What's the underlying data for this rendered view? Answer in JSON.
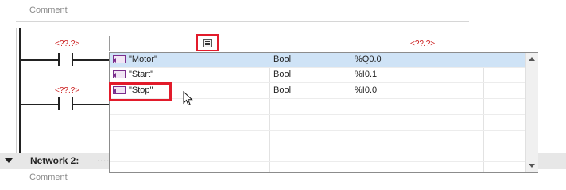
{
  "network1": {
    "comment": "Comment"
  },
  "network2": {
    "title": "Network 2:",
    "dots": "........",
    "comment": "Comment"
  },
  "ladder": {
    "contact1_address": "<??.?>",
    "contact2_address": "<??.?>",
    "coil_address": "<??.?>"
  },
  "operand_input": {
    "value": ""
  },
  "list_button": {
    "icon": "list-icon"
  },
  "tag_list": {
    "rows": [
      {
        "name": "\"Motor\"",
        "type": "Bool",
        "address": "%Q0.0",
        "selected": true
      },
      {
        "name": "\"Start\"",
        "type": "Bool",
        "address": "%I0.1",
        "selected": false
      },
      {
        "name": "\"Stop\"",
        "type": "Bool",
        "address": "%I0.0",
        "selected": false
      }
    ]
  },
  "colors": {
    "highlight": "#e21b2b",
    "selection": "#cfe3f6",
    "address": "#cc2020",
    "tag_icon": "#7a2d8c"
  }
}
